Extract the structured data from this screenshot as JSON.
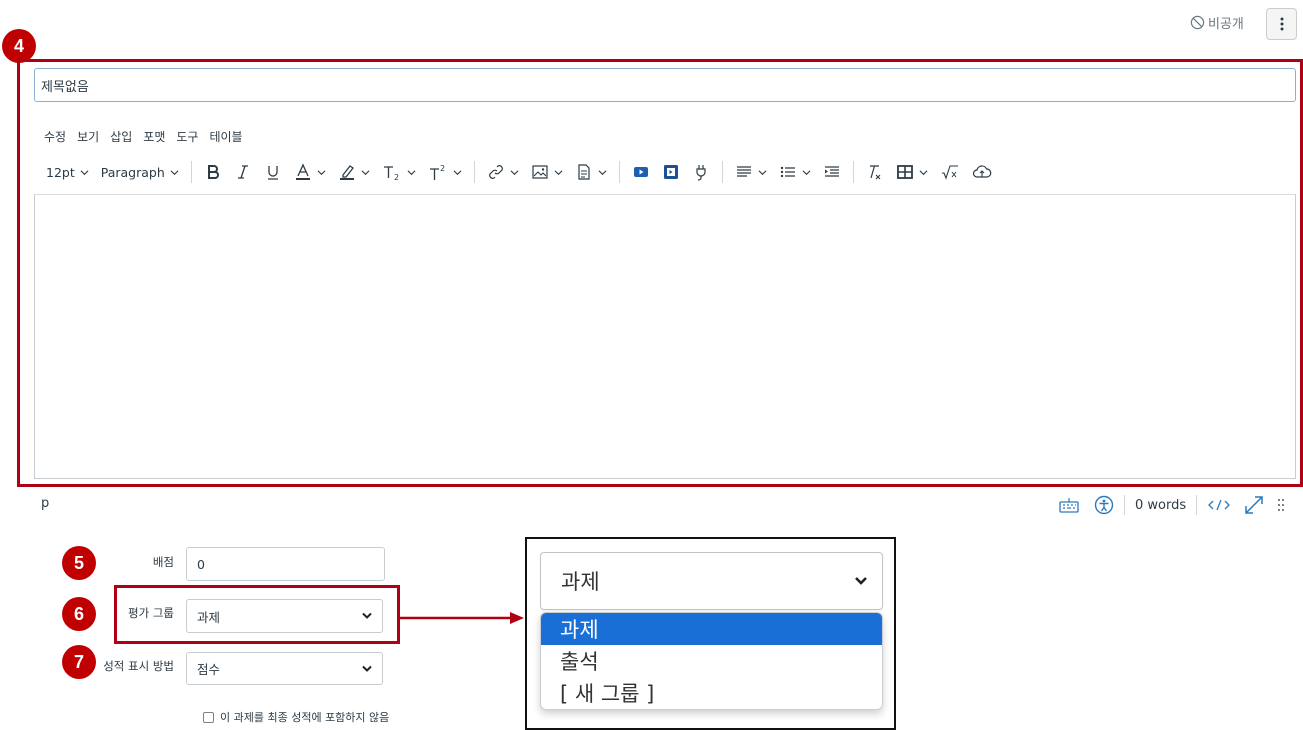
{
  "header": {
    "unpublished_label": "비공개"
  },
  "callouts": {
    "title_editor": "4",
    "points": "5",
    "assignment_group": "6",
    "display_grade": "7"
  },
  "title_input": {
    "value": "제목없음"
  },
  "menubar": {
    "items": [
      "수정",
      "보기",
      "삽입",
      "포맷",
      "도구",
      "테이블"
    ]
  },
  "toolbar": {
    "font_size": "12pt",
    "block_format": "Paragraph"
  },
  "statusbar": {
    "path": "p",
    "word_count": "0 words"
  },
  "form": {
    "points_label": "배점",
    "points_value": "0",
    "group_label": "평가 그룹",
    "group_value": "과제",
    "display_label": "성적 표시 방법",
    "display_value": "점수",
    "exclude_label": "이 과제를 최종 성적에 포함하지 않음"
  },
  "zoom_dropdown": {
    "selected": "과제",
    "options": [
      "과제",
      "출석",
      "[ 새 그룹 ]"
    ],
    "highlighted_index": 0
  },
  "colors": {
    "callout": "#c00000",
    "frame": "#b00014",
    "selection": "#1a6fd6",
    "link": "#2b7abc"
  }
}
